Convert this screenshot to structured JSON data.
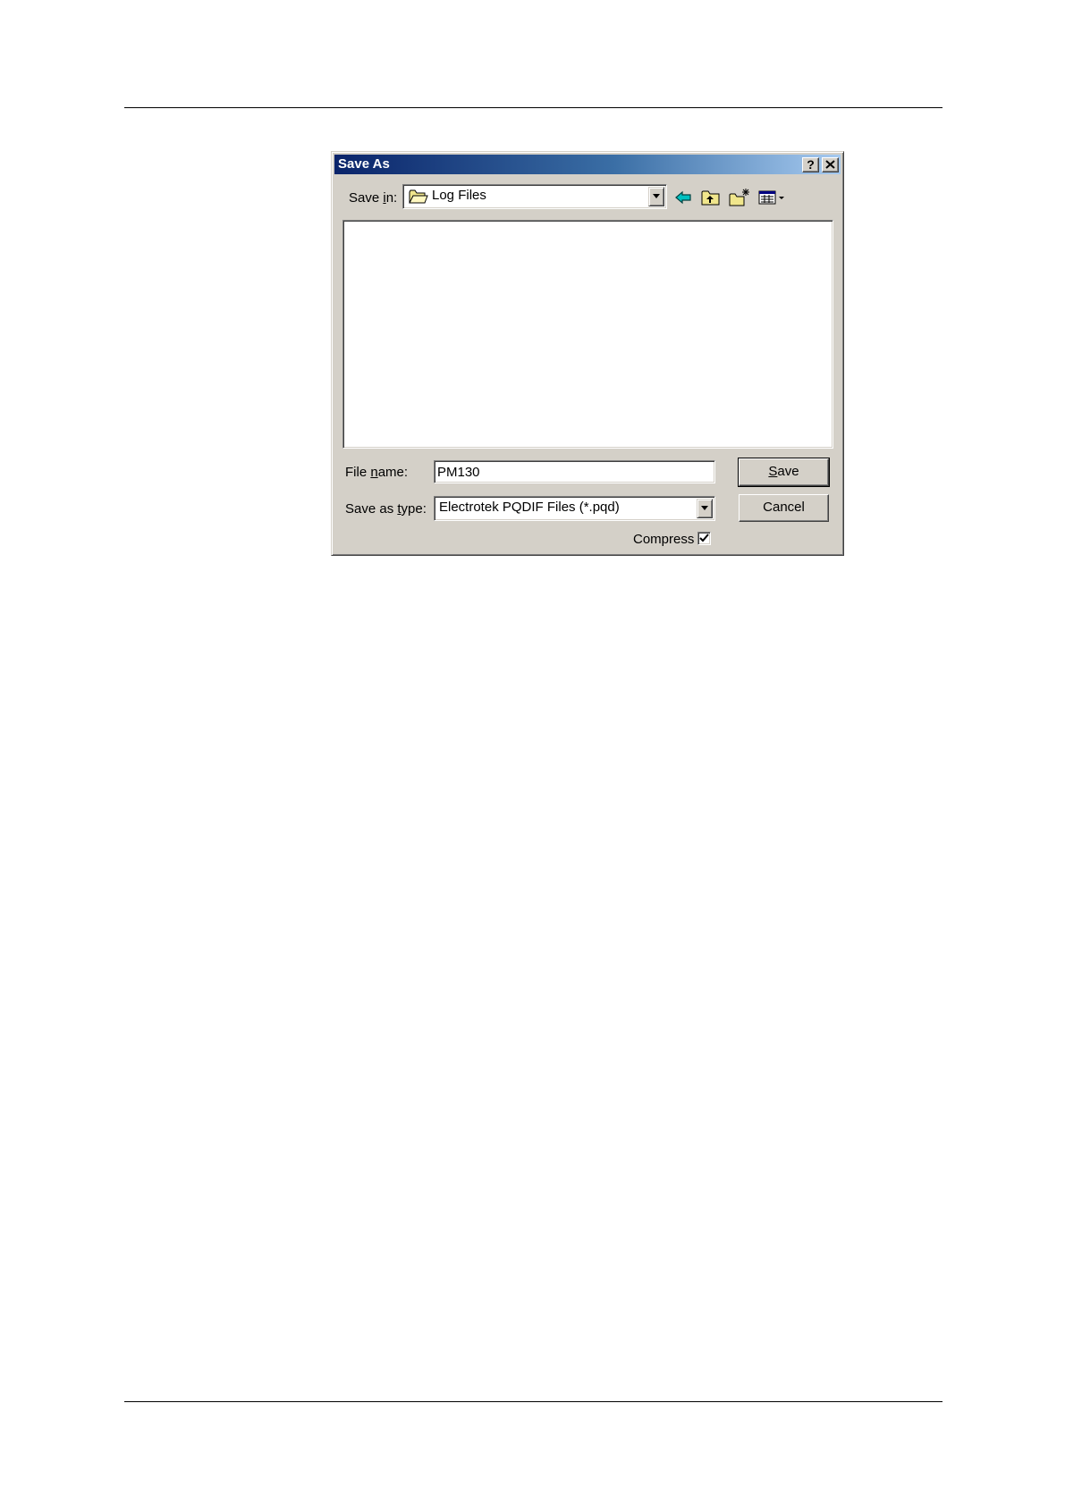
{
  "dialog": {
    "title": "Save As",
    "help_button": "?",
    "close_button": "×",
    "save_in": {
      "label_pre": "Save ",
      "label_access": "i",
      "label_post": "n:",
      "value": "Log Files"
    },
    "toolbar": {
      "icons": [
        "back-icon",
        "up-folder-icon",
        "new-folder-icon",
        "view-menu-icon"
      ]
    },
    "file_name": {
      "label_pre": "File ",
      "label_access": "n",
      "label_post": "ame:",
      "value": "PM130"
    },
    "save_as_type": {
      "label_pre": "Save as ",
      "label_access": "t",
      "label_post": "ype:",
      "value": "Electrotek PQDIF Files (*.pqd)"
    },
    "save_button": {
      "access": "S",
      "rest": "ave"
    },
    "cancel_button": "Cancel",
    "compress": {
      "label": "Compress",
      "checked": true
    }
  },
  "colors": {
    "face": "#d4d0c8",
    "title_start": "#0a246a",
    "title_end": "#a6caf0",
    "folder_yellow": "#f0e68c"
  }
}
